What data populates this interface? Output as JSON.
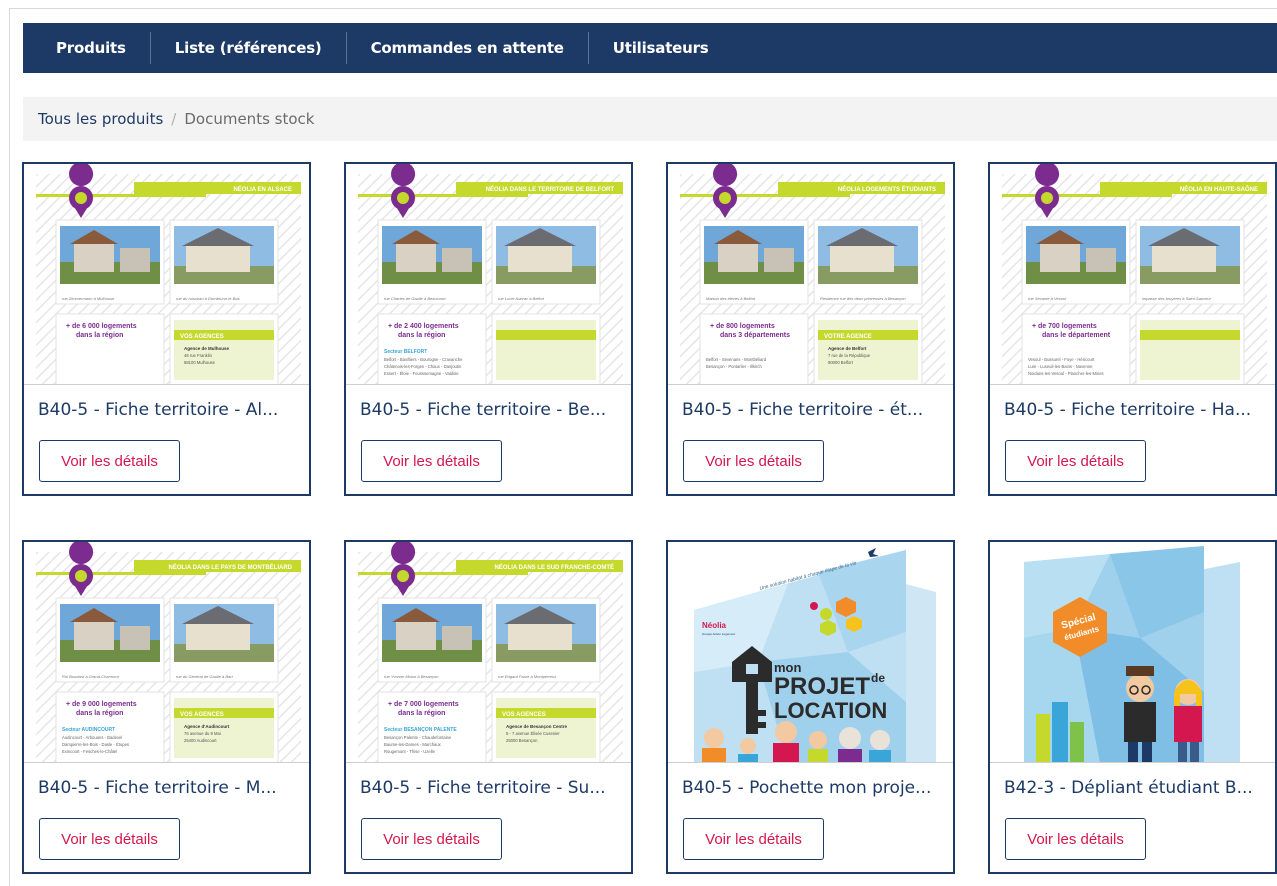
{
  "nav": {
    "items": [
      {
        "label": "Produits"
      },
      {
        "label": "Liste (références)"
      },
      {
        "label": "Commandes en attente"
      },
      {
        "label": "Utilisateurs"
      }
    ]
  },
  "breadcrumb": {
    "root": "Tous les produits",
    "separator": "/",
    "current": "Documents stock"
  },
  "colors": {
    "navy": "#1d3a66",
    "accent_red": "#d4174e",
    "lime": "#c5d92d",
    "purple": "#7b2c8e",
    "sky": "#3aa5d8"
  },
  "products": [
    {
      "title": "B40-5 - Fiche territoire - Al...",
      "button": "Voir les détails",
      "thumb": {
        "kind": "fiche",
        "banner": "NÉOLIA EN ALSACE",
        "caption_left": "rue Zimmermann à Mulhouse",
        "caption_right": "rue du ruisseau à Dornbrunn-le-Bas",
        "stat_line1": "+ de 6 000 logements",
        "stat_line2": "dans la région",
        "agency_header": "VOS AGENCES",
        "agency_line1": "Agence de Mulhouse",
        "agency_line2": "48 rue Franklin",
        "agency_line3": "68100 Mulhouse",
        "sector_title": "",
        "sector_line1": "",
        "sector_line2": "",
        "sector_line3": ""
      }
    },
    {
      "title": "B40-5 - Fiche territoire - Be...",
      "button": "Voir les détails",
      "thumb": {
        "kind": "fiche",
        "banner": "NÉOLIA DANS LE TERRITOIRE DE BELFORT",
        "caption_left": "rue Charles de Gaulle à Beaucourt",
        "caption_right": "rue Lucie Aubrac à Belfort",
        "stat_line1": "+ de 2 400 logements",
        "stat_line2": "dans la région",
        "agency_header": "",
        "agency_line1": "",
        "agency_line2": "",
        "agency_line3": "",
        "sector_title": "Secteur BELFORT",
        "sector_line1": "Belfort - Bavilliers - Bourogne - Cravanche",
        "sector_line2": "Châtenois-les-Forges - Chaux - Danjoutin",
        "sector_line3": "Essert - Éloie - Fousssemagne - Valdoie"
      }
    },
    {
      "title": "B40-5 - Fiche territoire - ét...",
      "button": "Voir les détails",
      "thumb": {
        "kind": "fiche",
        "banner": "NÉOLIA LOGEMENTS ÉTUDIANTS",
        "caption_left": "Maison des élèves à Belfort",
        "caption_right": "Résidence rue des deux princesses à Besançon",
        "stat_line1": "+ de 800 logements",
        "stat_line2": "dans 3 départements",
        "agency_header": "VOTRE AGENCE",
        "agency_line1": "Agence de Belfort",
        "agency_line2": "7 rue de la République",
        "agency_line3": "90000 Belfort",
        "sector_title": "",
        "sector_line1": "Belfort - Sévenans - Montbéliard",
        "sector_line2": "Besançon - Pontarlier - Illkirch",
        "sector_line3": ""
      }
    },
    {
      "title": "B40-5 - Fiche territoire - Ha...",
      "button": "Voir les détails",
      "thumb": {
        "kind": "fiche",
        "banner": "NÉOLIA EN HAUTE-SAÔNE",
        "caption_left": "rue Sécante à Vesoul",
        "caption_right": "impasse des bruyères à Saint-Sauveur",
        "stat_line1": "+ de 700 logements",
        "stat_line2": "dans le département",
        "agency_header": "",
        "agency_line1": "",
        "agency_line2": "",
        "agency_line3": "",
        "sector_title": "",
        "sector_line1": "Vesoul - Bussurel - Foye - Héricourt",
        "sector_line2": "Lure - Luxeuil-les-Bains - Navenne",
        "sector_line3": "Noidans-les-Vesoul - Plancher-les-Mines"
      }
    },
    {
      "title": "B40-5 - Fiche territoire - M...",
      "button": "Voir les détails",
      "thumb": {
        "kind": "fiche",
        "banner": "NÉOLIA DANS LE PAYS DE MONTBÉLIARD",
        "caption_left": "Rol Boudard à Grand-Charmont",
        "caption_right": "rue du Général de Gaulle à Bart",
        "stat_line1": "+ de 9 000 logements",
        "stat_line2": "dans la région",
        "agency_header": "VOS AGENCES",
        "agency_line1": "Agence d'Audincourt",
        "agency_line2": "76 avenue du 8 Mai",
        "agency_line3": "25400 Audincourt",
        "sector_title": "Secteur AUDINCOURT",
        "sector_line1": "Audincourt - Arbouans - Badevel",
        "sector_line2": "Dampierre-les-Bois - Dasle - Étupes",
        "sector_line3": "Exincourt - Fesches-le-Châtel"
      }
    },
    {
      "title": "B40-5 - Fiche territoire - Su...",
      "button": "Voir les détails",
      "thumb": {
        "kind": "fiche",
        "banner": "NÉOLIA DANS LE SUD FRANCHE-COMTÉ",
        "caption_left": "rue Yvonne Moion à Besançon",
        "caption_right": "rue Edgard Faure à Montperreux",
        "stat_line1": "+ de 7 000 logements",
        "stat_line2": "dans la région",
        "agency_header": "VOS AGENCES",
        "agency_line1": "Agence de Besançon Centre",
        "agency_line2": "5 - 7 avenue Élisée Cusenier",
        "agency_line3": "25000 Besançon",
        "sector_title": "Secteur BESANÇON PALENTE",
        "sector_line1": "Besançon Palente - Chaudefontaine",
        "sector_line2": "Baume-les-Dames - Marchaux",
        "sector_line3": "Rougemont - Thise - Uzelle"
      }
    },
    {
      "title": "B40-5 - Pochette mon proje...",
      "button": "Voir les détails",
      "thumb": {
        "kind": "pochette",
        "tagline": "Une solution habitat à chaque étape de la vie",
        "brand": "Néolia",
        "brand_sub": "Groupe Action Logement",
        "word_mon": "mon",
        "word_projet": "PROJET",
        "word_de": "de",
        "word_location": "LOCATION"
      }
    },
    {
      "title": "B42-3 - Dépliant étudiant B...",
      "button": "Voir les détails",
      "thumb": {
        "kind": "depliant",
        "badge_line1": "Spécial",
        "badge_line2": "étudiants"
      }
    }
  ]
}
